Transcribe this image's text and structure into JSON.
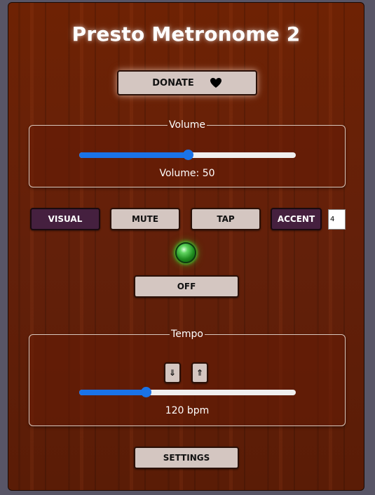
{
  "app": {
    "title": "Presto Metronome 2"
  },
  "donate": {
    "label": "DONATE",
    "icon": "heart-icon"
  },
  "volume": {
    "legend": "Volume",
    "value": 50,
    "text": "Volume: 50",
    "max": 100
  },
  "controls": {
    "visual_label": "VISUAL",
    "mute_label": "MUTE",
    "tap_label": "TAP",
    "accent_label": "ACCENT",
    "accent_value": "4"
  },
  "indicator": {
    "icon": "green-led-icon",
    "color": "#2fbf2f"
  },
  "power": {
    "label": "OFF"
  },
  "tempo": {
    "legend": "Tempo",
    "down_icon": "⇓",
    "up_icon": "⇑",
    "bpm_text": "120 bpm",
    "value": 120,
    "min": 40,
    "max": 300
  },
  "settings": {
    "label": "SETTINGS"
  },
  "colors": {
    "accent_blue": "#1a73e8",
    "button_bg": "#d4c6c1",
    "purple_button_bg": "#45203f",
    "wood": "#63200a"
  }
}
